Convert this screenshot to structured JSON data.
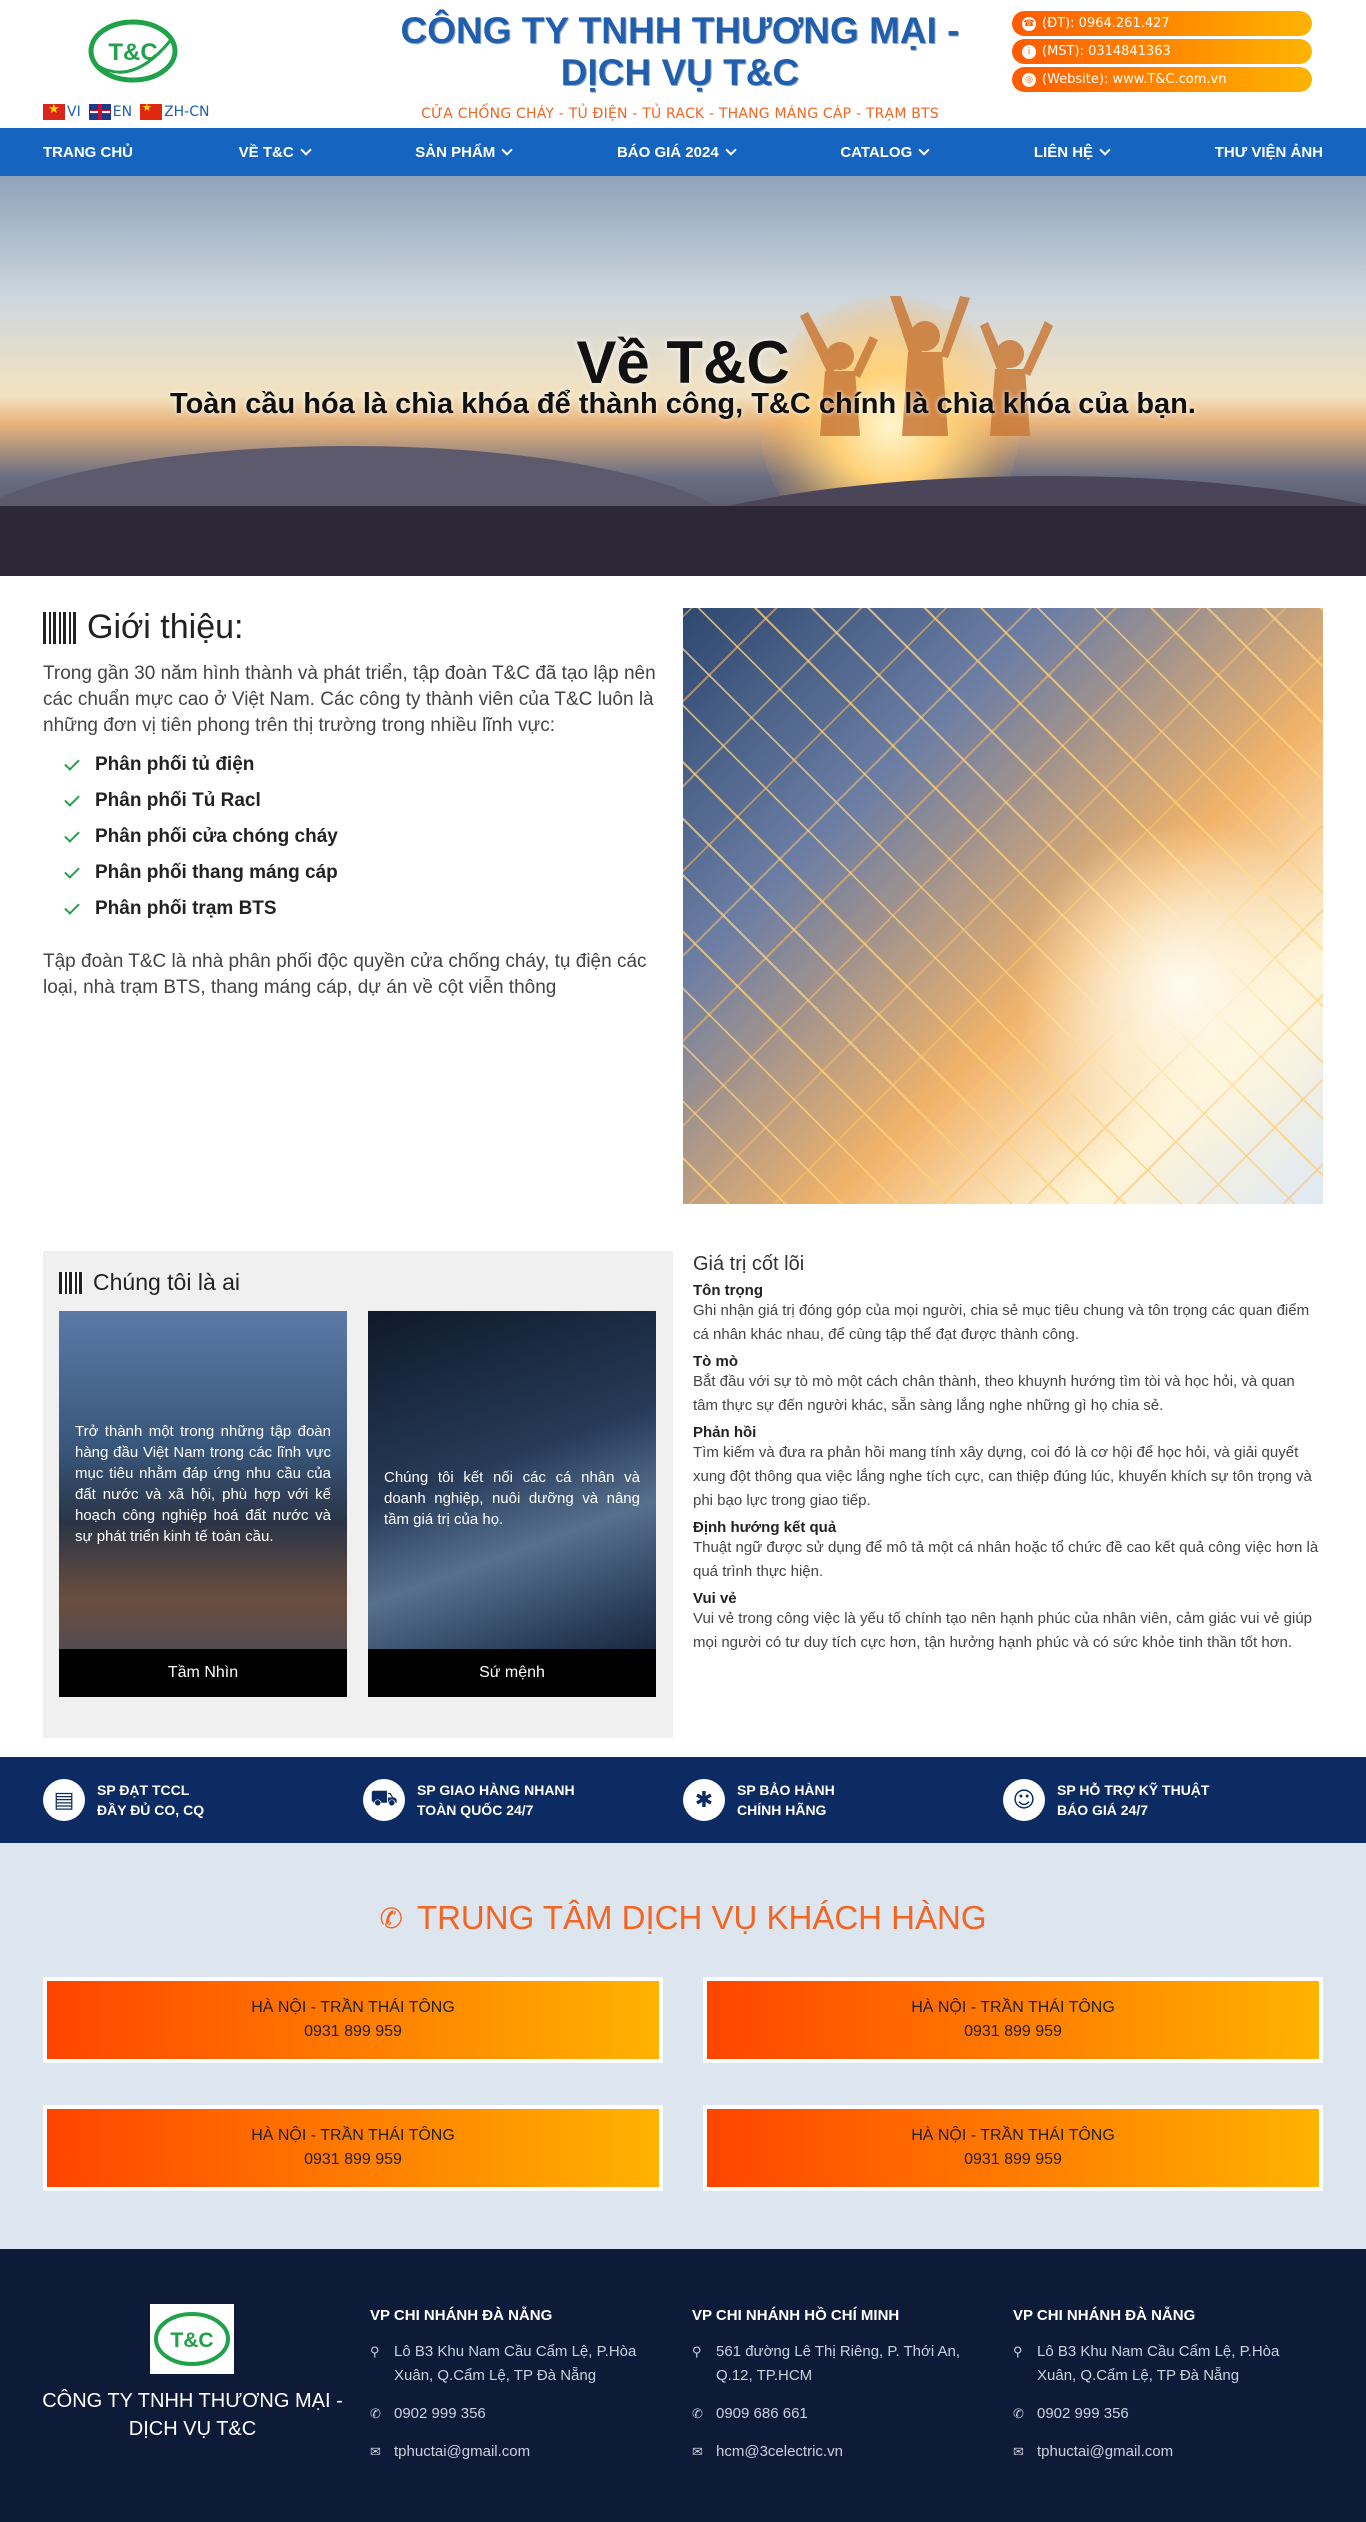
{
  "header": {
    "company_line1": "CÔNG TY TNHH THƯƠNG MẠI -",
    "company_line2": "DỊCH VỤ T&C",
    "tagline": "CỬA CHỐNG CHÁY - TỦ ĐIỆN - TỦ RACK - THANG MÁNG CÁP - TRẠM BTS",
    "logo_text": "T&C",
    "languages": [
      {
        "code": "VI",
        "label": "VI"
      },
      {
        "code": "EN",
        "label": "EN"
      },
      {
        "code": "ZH",
        "label": "ZH-CN"
      }
    ],
    "contacts": [
      {
        "icon": "phone-icon",
        "text": "(ĐT): 0964.261.427"
      },
      {
        "icon": "info-icon",
        "text": "(MST): 0314841363"
      },
      {
        "icon": "globe-icon",
        "text": "(Website): www.T&C.com.vn"
      }
    ]
  },
  "nav": {
    "items": [
      {
        "label": "TRANG CHỦ",
        "dropdown": false
      },
      {
        "label": "VỀ T&C",
        "dropdown": true
      },
      {
        "label": "SẢN PHẨM",
        "dropdown": true
      },
      {
        "label": "BÁO GIÁ 2024",
        "dropdown": true
      },
      {
        "label": "CATALOG",
        "dropdown": true
      },
      {
        "label": "LIÊN HỆ",
        "dropdown": true
      },
      {
        "label": "THƯ VIỆN ẢNH",
        "dropdown": false
      }
    ]
  },
  "hero": {
    "title": "Về T&C",
    "subtitle": "Toàn cầu hóa là chìa khóa để thành công, T&C chính là chìa khóa của bạn."
  },
  "intro": {
    "heading": "Giới thiệu:",
    "paragraph": "Trong gần 30 năm hình thành và phát triển, tập đoàn T&C đã tạo lập nên các chuẩn mực cao ở Việt Nam. Các công ty thành viên của T&C luôn là những đơn vị tiên phong trên thị trường trong nhiều lĩnh vực:",
    "list": [
      "Phân phối tủ điện",
      "Phân phối Tủ Racl",
      "Phân phối cửa chóng cháy",
      "Phân phối thang máng cáp",
      "Phân phối trạm BTS"
    ],
    "paragraph2": "Tập đoàn T&C là nhà phân phối độc quyền cửa chống cháy, tụ điện các loại, nhà trạm BTS, thang máng cáp, dự án về cột viễn thông"
  },
  "who": {
    "heading": "Chúng tôi là ai",
    "cards": [
      {
        "text": "Trở thành một trong những tập đoàn hàng đầu Việt Nam trong các lĩnh vực mục tiêu nhằm đáp ứng nhu cầu của đất nước và xã hội, phù hợp với kế hoạch công nghiệp hoá đất nước và sự phát triển kinh tế toàn cầu.",
        "label": "Tầm Nhìn"
      },
      {
        "text": "Chúng tôi kết nối các cá nhân và doanh nghiệp, nuôi dưỡng và nâng tầm giá trị của họ.",
        "label": "Sứ mệnh"
      }
    ]
  },
  "values": {
    "title": "Giá trị cốt lõi",
    "items": [
      {
        "name": "Tôn trọng",
        "desc": "Ghi nhận giá trị đóng góp của mọi người, chia sẻ mục tiêu chung và tôn trọng các quan điểm cá nhân khác nhau, để cùng tập thể đạt được thành công."
      },
      {
        "name": "Tò mò",
        "desc": "Bắt đầu với sự tò mò một cách chân thành, theo khuynh hướng tìm tòi và học hỏi, và quan tâm thực sự đến người khác, sẵn sàng lắng nghe những gì họ chia sẻ."
      },
      {
        "name": "Phản hồi",
        "desc": "Tìm kiếm và đưa ra phản hồi mang tính xây dựng, coi đó là cơ hội để học hỏi, và giải quyết xung đột thông qua việc lắng nghe tích cực, can thiệp đúng lúc, khuyến khích sự tôn trọng và phi bạo lực trong giao tiếp."
      },
      {
        "name": "Định hướng kết quả",
        "desc": "Thuật ngữ được sử dụng để mô tả một cá nhân hoặc tổ chức đề cao kết quả công việc hơn là quá trình thực hiện."
      },
      {
        "name": "Vui vẻ",
        "desc": "Vui vẻ trong công việc là yếu tố chính tạo nên hạnh phúc của nhân viên, cảm giác vui vẻ giúp mọi người có tư duy tích cực hơn, tận hưởng hạnh phúc và có sức khỏe tinh thần tốt hơn."
      }
    ]
  },
  "features": [
    {
      "icon": "certificate-icon",
      "line1": "SP ĐẠT TCCL",
      "line2": "ĐẦY ĐỦ CO, CQ"
    },
    {
      "icon": "truck-icon",
      "line1": "SP GIAO HÀNG NHANH",
      "line2": "TOÀN QUỐC 24/7"
    },
    {
      "icon": "warranty-icon",
      "line1": "SP BẢO HÀNH",
      "line2": "CHÍNH HÃNG"
    },
    {
      "icon": "support-icon",
      "line1": "SP HỖ TRỢ KỸ THUẬT",
      "line2": "BÁO GIÁ 24/7"
    }
  ],
  "service": {
    "title": "TRUNG TÂM DỊCH VỤ KHÁCH HÀNG",
    "boxes": [
      {
        "name": "HÀ NỘI - TRẦN THÁI TÔNG",
        "phone": "0931 899 959"
      },
      {
        "name": "HÀ NỘI - TRẦN THÁI TÔNG",
        "phone": "0931 899 959"
      },
      {
        "name": "HÀ NỘI - TRẦN THÁI TÔNG",
        "phone": "0931 899 959"
      },
      {
        "name": "HÀ NỘI - TRẦN THÁI TÔNG",
        "phone": "0931 899 959"
      }
    ]
  },
  "footer": {
    "logo_text": "T&C",
    "company_line1": "CÔNG TY TNHH THƯƠNG MẠI -",
    "company_line2": "DỊCH VỤ T&C",
    "branches": [
      {
        "title": "VP CHI NHÁNH ĐÀ NẴNG",
        "address": "Lô B3 Khu Nam Cầu Cẩm Lệ, P.Hòa Xuân, Q.Cẩm Lệ, TP Đà Nẵng",
        "phone": "0902 999 356",
        "email": "tphuctai@gmail.com"
      },
      {
        "title": "VP CHI NHÁNH HỒ CHÍ MINH",
        "address": "561 đường Lê Thị Riêng, P. Thới An, Q.12, TP.HCM",
        "phone": "0909 686 661",
        "email": "hcm@3celectric.vn"
      },
      {
        "title": "VP CHI NHÁNH ĐÀ NẴNG",
        "address": "Lô B3 Khu Nam Cầu Cẩm Lệ, P.Hòa Xuân, Q.Cẩm Lệ, TP Đà Nẵng",
        "phone": "0902 999 356",
        "email": "tphuctai@gmail.com"
      }
    ]
  },
  "colors": {
    "brand_blue": "#1565c0",
    "title_blue": "#1f5fae",
    "accent_orange": "#f26522",
    "navy": "#0b2b62",
    "footer_bg": "#0e1b38",
    "check_green": "#1fa24a"
  }
}
